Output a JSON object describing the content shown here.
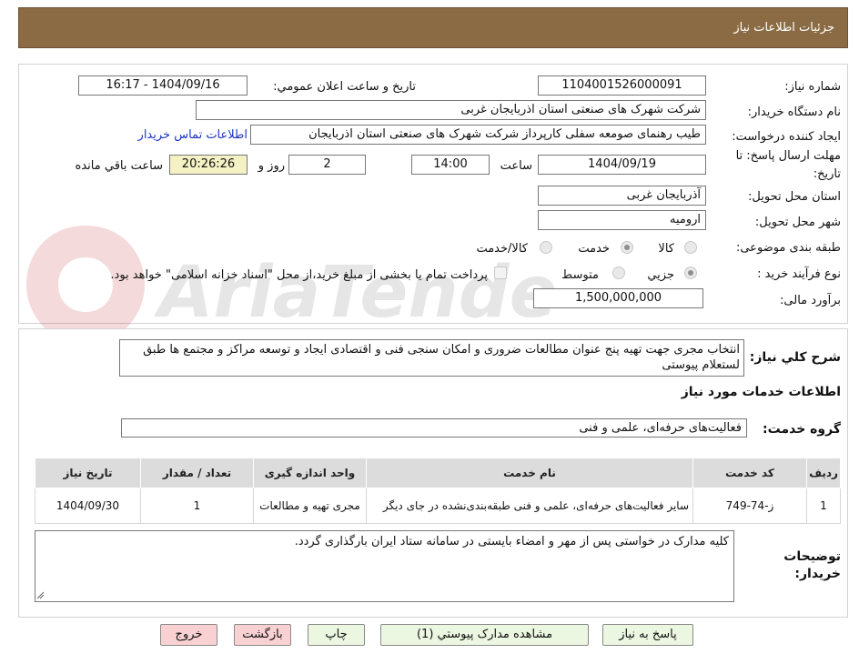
{
  "header": {
    "title": "جزئیات اطلاعات نیاز"
  },
  "need_number": {
    "label": "شماره نیاز:",
    "value": "1104001526000091"
  },
  "announce": {
    "label": "تاریخ و ساعت اعلان عمومي:",
    "value": "1404/09/16 - 16:17"
  },
  "buyer_org": {
    "label": "نام دستگاه خريدار:",
    "value": "شرکت شهرک های صنعتی استان اذربایجان غربی"
  },
  "requester": {
    "label": "ايجاد کننده درخواست:",
    "value": "طیب رهنمای صومعه سفلی کارپرداز شرکت شهرک های صنعتی استان اذربایجان",
    "contact_link": "اطلاعات تماس خریدار"
  },
  "deadline": {
    "label_line1": "مهلت ارسال پاسخ: تا",
    "label_line2": "تاریخ:",
    "date": "1404/09/19",
    "time_label": "ساعت",
    "time": "14:00",
    "days": "2",
    "day_label": "روز و",
    "remaining": "20:26:26",
    "remaining_label": "ساعت باقي مانده"
  },
  "province": {
    "label": "استان محل تحویل:",
    "value": "آذربایجان غربی"
  },
  "city": {
    "label": "شهر محل تحویل:",
    "value": "ارومیه"
  },
  "category": {
    "label": "طبقه بندی موضوعی:",
    "options": [
      "کالا",
      "خدمت",
      "کالا/خدمت"
    ],
    "selected": "خدمت"
  },
  "process": {
    "label": "نوع فرآیند خرید :",
    "options": [
      "جزیي",
      "متوسط"
    ],
    "selected": "جزیي",
    "payment_note": "پرداخت تمام یا بخشی از مبلغ خرید،از محل \"اسناد خزانه اسلامی\" خواهد بود."
  },
  "budget": {
    "label": "برآورد مالی:",
    "value": "1,500,000,000"
  },
  "description": {
    "label": "شرح کلي نياز:",
    "text": "انتخاب مجری جهت تهیه پنج عنوان مطالعات ضروری و امکان سنجی فنی و اقتصادی ایجاد و توسعه مراکز و مجتمع ها طبق لستعلام پیوستی"
  },
  "services_title": "اطلاعات خدمات مورد نیاز",
  "service_group": {
    "label": "گروه خدمت:",
    "value": "فعالیت‌های حرفه‌ای، علمی و فنی"
  },
  "table": {
    "headers": [
      "رديف",
      "کد خدمت",
      "نام خدمت",
      "واحد اندازه گیری",
      "تعداد / مقدار",
      "تاریخ نیاز"
    ],
    "rows": [
      [
        "1",
        "ز-74-749",
        "سایر فعالیت‌های حرفه‌ای، علمی و فنی طبقه‌بندی‌نشده در جای دیگر",
        "مجری تهیه و مطالعات",
        "1",
        "1404/09/30"
      ]
    ]
  },
  "buyer_notes": {
    "label_line1": "توضیحات",
    "label_line2": "خریدار:",
    "text": "کلیه مدارک در خواستی پس از مهر و امضاء بایستی در سامانه ستاد ایران بارگذاری گردد."
  },
  "buttons": {
    "reply": "پاسخ به نیاز",
    "attachments": "مشاهده مدارک پیوستي (1)",
    "print": "چاپ",
    "back": "بازگشت",
    "exit": "خروج"
  },
  "colors": {
    "header_bg": "#8b6b43",
    "remaining_bg": "#f4f1c4",
    "link": "#1a35c4",
    "button_green": "#ecf7e1",
    "button_red": "#f9d1d3"
  },
  "watermark_text": "AriaTender.net"
}
